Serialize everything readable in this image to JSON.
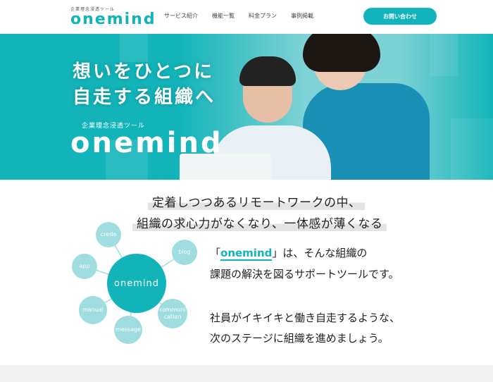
{
  "header": {
    "logo_tagline": "企業理念浸透ツール",
    "logo_word": "onemind",
    "nav": [
      "サービス紹介",
      "機能一覧",
      "料金プラン",
      "事例掲載"
    ],
    "contact_label": "お問い合わせ"
  },
  "hero": {
    "headline_line1": "想いをひとつに",
    "headline_line2": "自走する組織へ",
    "tagline": "企業理念浸透ツール",
    "logo_word": "onemind"
  },
  "intro": {
    "line1": "定着しつつあるリモートワークの中、",
    "line2": "組織の求心力がなくなり、一体感が薄くなる"
  },
  "diagram": {
    "center": "onemind",
    "nodes": [
      "credo",
      "blog",
      "app",
      "manual",
      "message",
      "communi cation"
    ]
  },
  "description": {
    "open_quote": "「",
    "brand": "onemind",
    "line1_rest": "」は、そんな組織の",
    "line2": "課題の解決を図るサポートツールです。",
    "line3": "社員がイキイキと働き自走するような、",
    "line4": "次のステージに組織を進めましょう。"
  },
  "colors": {
    "brand": "#12b4b9",
    "node": "#9fdde0"
  }
}
